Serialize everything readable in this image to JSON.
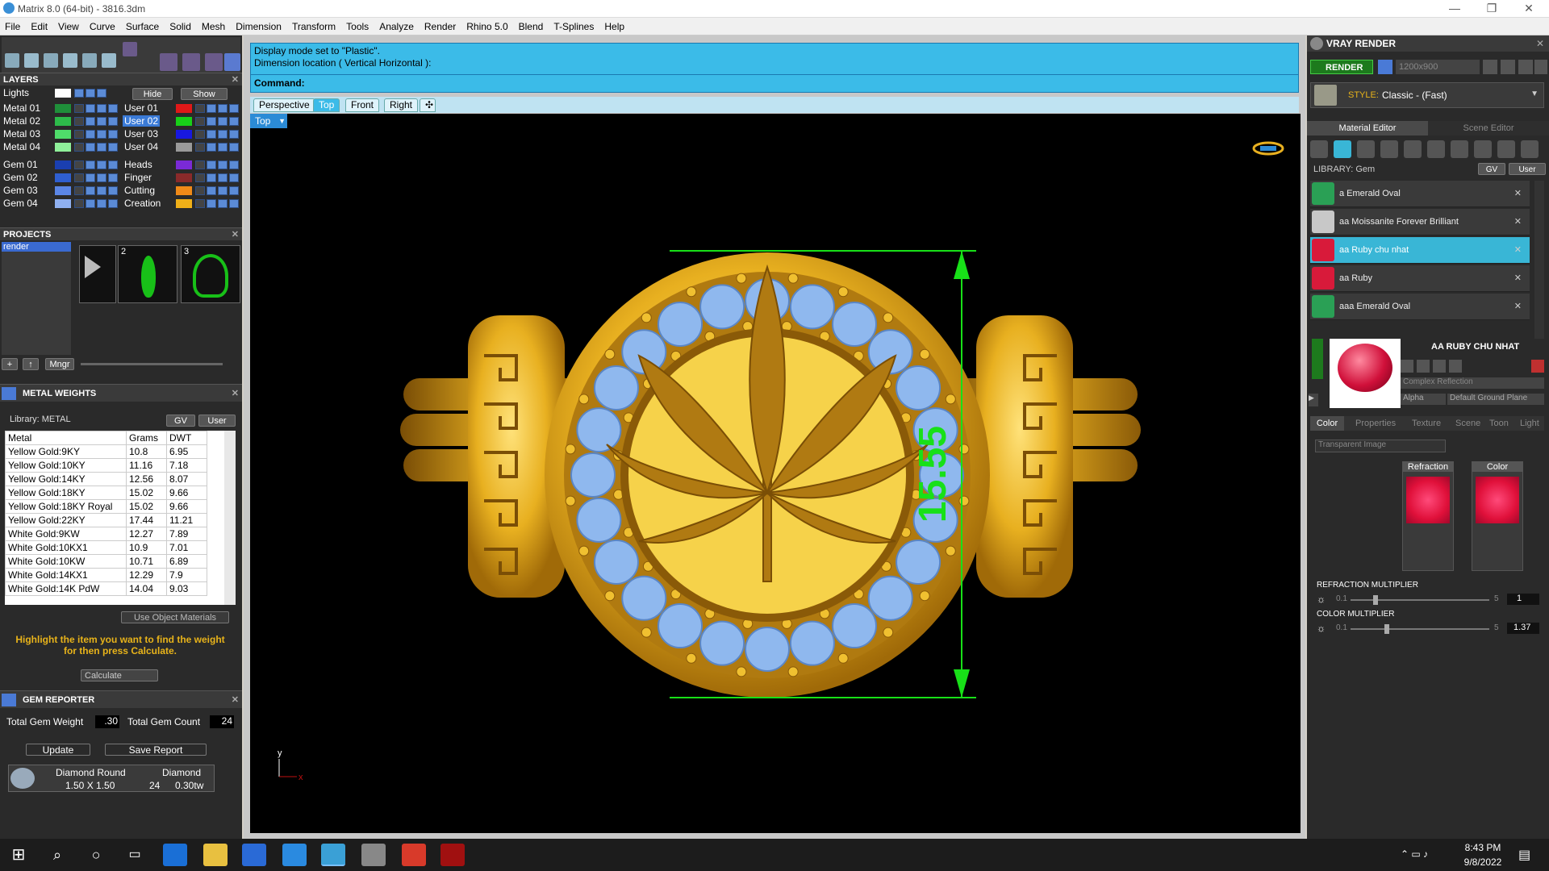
{
  "app": {
    "title": "Matrix 8.0 (64-bit) - 3816.3dm",
    "win_min": "—",
    "win_max": "❐",
    "win_close": "✕"
  },
  "menu": [
    "File",
    "Edit",
    "View",
    "Curve",
    "Surface",
    "Solid",
    "Mesh",
    "Dimension",
    "Transform",
    "Tools",
    "Analyze",
    "Render",
    "Rhino 5.0",
    "Blend",
    "T-Splines",
    "Help"
  ],
  "layers": {
    "title": "LAYERS",
    "lights_label": "Lights",
    "hide_label": "Hide",
    "show_label": "Show",
    "left": [
      {
        "name": "Metal 01",
        "color": "#1f8f3a"
      },
      {
        "name": "Metal 02",
        "color": "#2dbb4a"
      },
      {
        "name": "Metal 03",
        "color": "#4fdc6a"
      },
      {
        "name": "Metal 04",
        "color": "#8ff09a"
      },
      {
        "name": "Gem 01",
        "color": "#1a3fb0"
      },
      {
        "name": "Gem 02",
        "color": "#2f5fd0"
      },
      {
        "name": "Gem 03",
        "color": "#5b86e6"
      },
      {
        "name": "Gem 04",
        "color": "#8fb0f0"
      }
    ],
    "right": [
      {
        "name": "User 01",
        "color": "#e01818"
      },
      {
        "name": "User 02",
        "color": "#18d018"
      },
      {
        "name": "User 03",
        "color": "#1818e0"
      },
      {
        "name": "User 04",
        "color": "#9a9a9a"
      },
      {
        "name": "Heads",
        "color": "#7a2ad6"
      },
      {
        "name": "Finger",
        "color": "#8a2a2a"
      },
      {
        "name": "Cutting",
        "color": "#f08a18"
      },
      {
        "name": "Creation",
        "color": "#f0b018"
      }
    ]
  },
  "projects": {
    "title": "PROJECTS",
    "items": [
      "render"
    ],
    "thumb_nums": [
      "2",
      "3"
    ],
    "mngr_label": "Mngr"
  },
  "metal_weights": {
    "title": "METAL WEIGHTS",
    "library": "Library: METAL",
    "gv": "GV",
    "user": "User",
    "headers": [
      "Metal",
      "Grams",
      "DWT"
    ],
    "rows": [
      [
        "Yellow Gold:9KY",
        "10.8",
        "6.95"
      ],
      [
        "Yellow Gold:10KY",
        "11.16",
        "7.18"
      ],
      [
        "Yellow Gold:14KY",
        "12.56",
        "8.07"
      ],
      [
        "Yellow Gold:18KY",
        "15.02",
        "9.66"
      ],
      [
        "Yellow Gold:18KY Royal",
        "15.02",
        "9.66"
      ],
      [
        "Yellow Gold:22KY",
        "17.44",
        "11.21"
      ],
      [
        "White Gold:9KW",
        "12.27",
        "7.89"
      ],
      [
        "White Gold:10KX1",
        "10.9",
        "7.01"
      ],
      [
        "White Gold:10KW",
        "10.71",
        "6.89"
      ],
      [
        "White Gold:14KX1",
        "12.29",
        "7.9"
      ],
      [
        "White Gold:14K PdW",
        "14.04",
        "9.03"
      ]
    ],
    "use_object": "Use Object Materials",
    "hint": "Highlight the item you want to find the weight for then press Calculate.",
    "calculate": "Calculate"
  },
  "gem_reporter": {
    "title": "GEM REPORTER",
    "total_weight_label": "Total Gem Weight",
    "total_weight": ".30",
    "total_count_label": "Total Gem Count",
    "total_count": "24",
    "update": "Update",
    "save_report": "Save Report",
    "gem_name": "Diamond Round",
    "gem_size": "1.50 X 1.50",
    "gem_type": "Diamond",
    "gem_count": "24",
    "gem_weight": "0.30tw"
  },
  "command": {
    "line1": "Display mode set to \"Plastic\".",
    "line2": "Dimension location ( Vertical  Horizontal ):",
    "prompt": "Command:"
  },
  "view_tabs": [
    "Perspective",
    "Top",
    "Front",
    "Right"
  ],
  "active_tab": "Top",
  "viewport": {
    "label": "Top",
    "dimension": "15.55",
    "axis_y": "y",
    "axis_x": "x",
    "dim_color": "#18e018"
  },
  "vray": {
    "title": "VRAY RENDER",
    "render": "RENDER",
    "resolution": "1200x900",
    "style_label": "STYLE:",
    "style_value": "Classic - (Fast)",
    "tab_material": "Material Editor",
    "tab_scene": "Scene Editor",
    "library": "LIBRARY: Gem",
    "gv": "GV",
    "user": "User",
    "materials": [
      {
        "name": "a Emerald Oval",
        "color": "#2aa055"
      },
      {
        "name": "aa Moissanite Forever Brilliant",
        "color": "#c8c8c8"
      },
      {
        "name": "aa Ruby chu nhat",
        "color": "#d81a3a"
      },
      {
        "name": "aa Ruby",
        "color": "#d81a3a"
      },
      {
        "name": "aaa Emerald Oval",
        "color": "#2aa055"
      }
    ],
    "selected_name": "AA RUBY CHU NHAT",
    "reflection": "Complex Reflection",
    "alpha": "Alpha",
    "ground": "Default Ground Plane",
    "subtabs": [
      "Color",
      "Properties",
      "Texture",
      "Scene",
      "Toon",
      "Light"
    ],
    "transparent": "Transparent Image",
    "refraction_label": "Refraction",
    "color_label": "Color",
    "refraction_mult_label": "REFRACTION MULTIPLIER",
    "refraction_min": "0.1",
    "refraction_max": "5",
    "refraction_val": "1",
    "refraction_level": 0.18,
    "color_mult_label": "COLOR MULTIPLIER",
    "color_min": "0.1",
    "color_max": "5",
    "color_val": "1.37",
    "color_level": 0.26,
    "swatch_color": "#e0103a"
  },
  "taskbar": {
    "time": "8:43 PM",
    "date": "9/8/2022"
  }
}
